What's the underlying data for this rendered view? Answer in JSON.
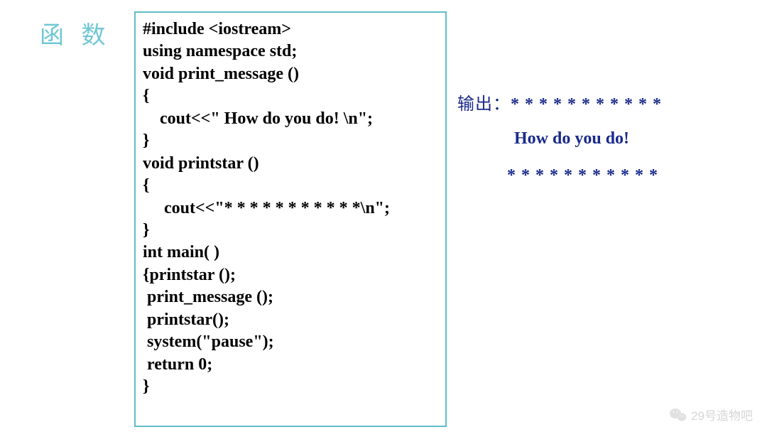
{
  "title": "函 数",
  "code": {
    "l1": "#include <iostream>",
    "l2": "using namespace std;",
    "l3": "void print_message ()",
    "l4": "{",
    "l5": "    cout<<\" How do you do! \\n\";",
    "l6": "}",
    "l7": "void printstar ()",
    "l8": "{",
    "l9": "     cout<<\"* * * * * * * * * * *\\n\";",
    "l10": "}",
    "l11": "int main( )",
    "l12": "{printstar ();",
    "l13": " print_message ();",
    "l14": " printstar();",
    "l15": " system(\"pause\");",
    "l16": " return 0;",
    "l17": "}"
  },
  "output": {
    "label": "输出：",
    "line1": "* * * * * * * * * * *",
    "line2": "How do you do!",
    "line3": "* * * * * * * * * * *"
  },
  "watermark": "29号造物吧"
}
